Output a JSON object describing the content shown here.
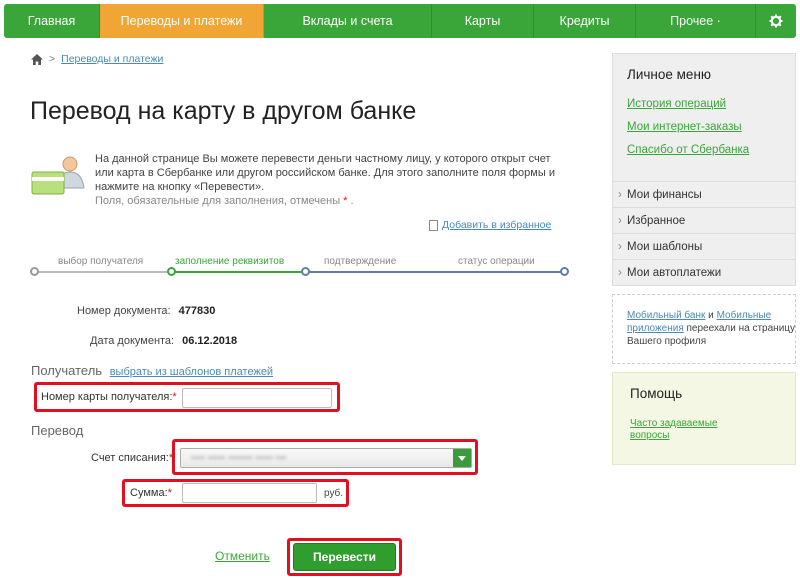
{
  "nav": {
    "items": [
      "Главная",
      "Переводы и платежи",
      "Вклады и счета",
      "Карты",
      "Кредиты",
      "Прочее"
    ],
    "dropdown_marker": "·",
    "active_index": 1,
    "settings_icon": "gear-icon"
  },
  "breadcrumb": {
    "home_icon": "home-icon",
    "separator": ">",
    "link": "Переводы и платежи"
  },
  "page": {
    "title": "Перевод на карту в другом банке"
  },
  "info": {
    "text": "На данной странице Вы можете перевести деньги частному лицу, у которого открыт счет или карта в Сбербанке или другом российском банке. Для этого заполните поля формы и нажмите на кнопку «Перевести».",
    "required_note": "Поля, обязательные для заполнения, отмечены",
    "required_mark": "*",
    "required_suffix": "."
  },
  "favorites": {
    "label": "Добавить в избранное"
  },
  "steps": [
    {
      "label": "выбор получателя",
      "state": "done"
    },
    {
      "label": "заполнение реквизитов",
      "state": "active"
    },
    {
      "label": "подтверждение",
      "state": "pending"
    },
    {
      "label": "статус операции",
      "state": "pending"
    }
  ],
  "document": {
    "number_label": "Номер документа:",
    "number_value": "477830",
    "date_label": "Дата документа:",
    "date_value": "06.12.2018"
  },
  "recipient": {
    "title": "Получатель",
    "templates_link": "выбрать из шаблонов платежей",
    "card_label": "Номер карты получателя:",
    "card_value": ""
  },
  "transfer": {
    "title": "Перевод",
    "account_label": "Счет списания:",
    "account_value": "•••• ••••• ••••••• ••••• •••",
    "amount_label": "Сумма:",
    "amount_value": "",
    "currency": "руб."
  },
  "actions": {
    "cancel": "Отменить",
    "submit": "Перевести"
  },
  "sidebar": {
    "title": "Личное меню",
    "links": [
      "История операций",
      "Мои интернет-заказы",
      "Спасибо от Сбербанка"
    ],
    "sections": [
      "Мои финансы",
      "Избранное",
      "Мои шаблоны",
      "Мои автоплатежи"
    ]
  },
  "mobile_note": {
    "link1": "Мобильный банк",
    "and": " и ",
    "link2": "Мобильные приложения",
    "text": " переехали на страницу Вашего профиля"
  },
  "help": {
    "title": "Помощь",
    "link": "Часто задаваемые вопросы"
  },
  "colors": {
    "brand_green": "#3aa63a",
    "active_orange": "#f0a534",
    "highlight_red": "#e01020",
    "link_blue": "#4a89b8"
  }
}
